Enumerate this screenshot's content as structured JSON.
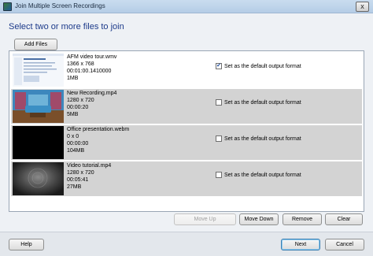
{
  "window": {
    "title": "Join Multiple Screen Recordings",
    "close_glyph": "x"
  },
  "heading": "Select two or more files to join",
  "buttons": {
    "add_files": "Add Files",
    "move_up": "Move Up",
    "move_down": "Move Down",
    "remove": "Remove",
    "clear": "Clear",
    "help": "Help",
    "next": "Next",
    "cancel": "Cancel"
  },
  "files": [
    {
      "name": "AFM video tour.wmv",
      "resolution": "1366 x 768",
      "duration": "00:01:00.1410000",
      "size": "1MB",
      "default_format": true,
      "checkbox_label": "Set as the default output format"
    },
    {
      "name": "New Recording.mp4",
      "resolution": "1280 x 720",
      "duration": "00:00:20",
      "size": "5MB",
      "default_format": false,
      "checkbox_label": "Set as the default output format"
    },
    {
      "name": "Office presentation.webm",
      "resolution": "0 x 0",
      "duration": "00:00:00",
      "size": "104MB",
      "default_format": false,
      "checkbox_label": "Set as the default output format"
    },
    {
      "name": "Video tutorial.mp4",
      "resolution": "1280 x 720",
      "duration": "00:05:41",
      "size": "27MB",
      "default_format": false,
      "checkbox_label": "Set as the default output format"
    }
  ],
  "icons": {
    "app": "app-icon",
    "checkmark": "✔"
  },
  "colors": {
    "heading": "#1c3a8a",
    "selected_row": "#ffffff",
    "unselected_row": "#d3d3d3"
  }
}
